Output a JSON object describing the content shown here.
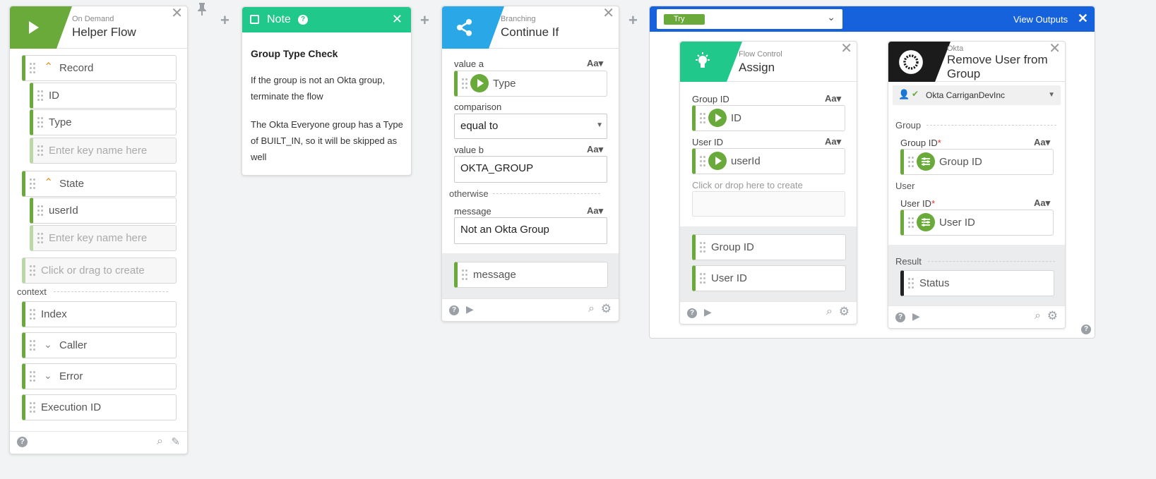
{
  "helper_flow": {
    "subtitle": "On Demand",
    "title": "Helper Flow",
    "fields": [
      {
        "label": "Record"
      },
      {
        "label": "ID"
      },
      {
        "label": "Type"
      },
      {
        "placeholder": "Enter key name here"
      },
      {
        "label": "State"
      },
      {
        "label": "userId"
      },
      {
        "placeholder": "Enter key name here"
      },
      {
        "placeholder": "Click or drag to create"
      }
    ],
    "context_label": "context",
    "context_fields": [
      {
        "label": "Index"
      },
      {
        "label": "Caller"
      },
      {
        "label": "Error"
      },
      {
        "label": "Execution ID"
      }
    ]
  },
  "note": {
    "title": "Note",
    "heading": "Group Type Check",
    "para1": "If the group is not an Okta group, terminate the flow",
    "para2": "The Okta Everyone group has a Type of BUILT_IN, so it will be skipped as well"
  },
  "continue_if": {
    "subtitle": "Branching",
    "title": "Continue If",
    "value_a_label": "value a",
    "value_a": "Type",
    "comparison_label": "comparison",
    "comparison_value": "equal to",
    "value_b_label": "value b",
    "value_b": "OKTA_GROUP",
    "otherwise_label": "otherwise",
    "message_label": "message",
    "message_value": "Not an Okta Group",
    "output_message": "message",
    "aa_label": "Aa"
  },
  "try_panel": {
    "badge": "Try",
    "view_outputs": "View Outputs"
  },
  "assign": {
    "subtitle": "Flow Control",
    "title": "Assign",
    "group_id_label": "Group ID",
    "group_id_value": "ID",
    "user_id_label": "User ID",
    "user_id_value": "userId",
    "create_hint": "Click or drop here to create",
    "outputs": [
      "Group ID",
      "User ID"
    ]
  },
  "remove_user": {
    "subtitle": "Okta",
    "title": "Remove User from Group",
    "connection": "Okta CarriganDevInc",
    "group_section": "Group",
    "group_id_label": "Group ID",
    "group_id_value": "Group ID",
    "user_section": "User",
    "user_id_label": "User ID",
    "user_id_value": "User ID",
    "result_label": "Result",
    "result_output": "Status",
    "required_mark": "*"
  },
  "colors": {
    "green": "#6aaa3a",
    "teal": "#20c98b",
    "blue": "#2aa7e6",
    "try_blue": "#1662dd",
    "okta_black": "#1b1b1b"
  }
}
